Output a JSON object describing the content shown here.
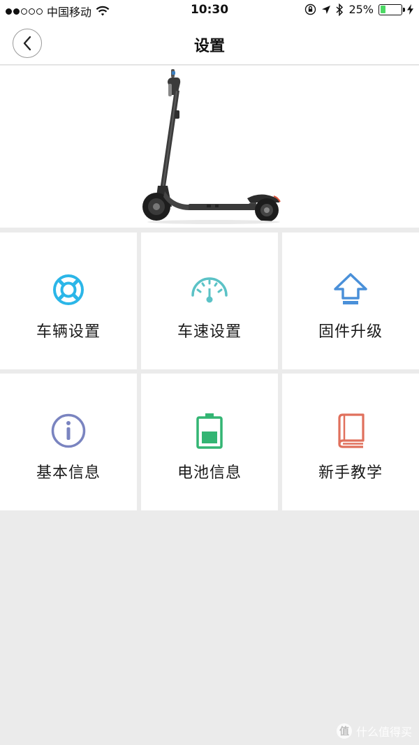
{
  "status_bar": {
    "carrier": "中国移动",
    "time": "10:30",
    "battery_percent": "25%",
    "battery_level": 0.25,
    "battery_color": "#4cd964"
  },
  "nav": {
    "title": "设置",
    "back_icon": "chevron-left-icon"
  },
  "menu": [
    {
      "label": "车辆设置",
      "icon": "lifebuoy-icon",
      "color": "#2bb6e8"
    },
    {
      "label": "车速设置",
      "icon": "speedometer-icon",
      "color": "#5bc2c6"
    },
    {
      "label": "固件升级",
      "icon": "arrow-up-icon",
      "color": "#4a90d9"
    },
    {
      "label": "基本信息",
      "icon": "info-icon",
      "color": "#7a84c0"
    },
    {
      "label": "电池信息",
      "icon": "battery-icon",
      "color": "#33b573"
    },
    {
      "label": "新手教学",
      "icon": "book-icon",
      "color": "#e0705c"
    }
  ],
  "watermark": {
    "text": "什么值得买",
    "badge": "值"
  }
}
